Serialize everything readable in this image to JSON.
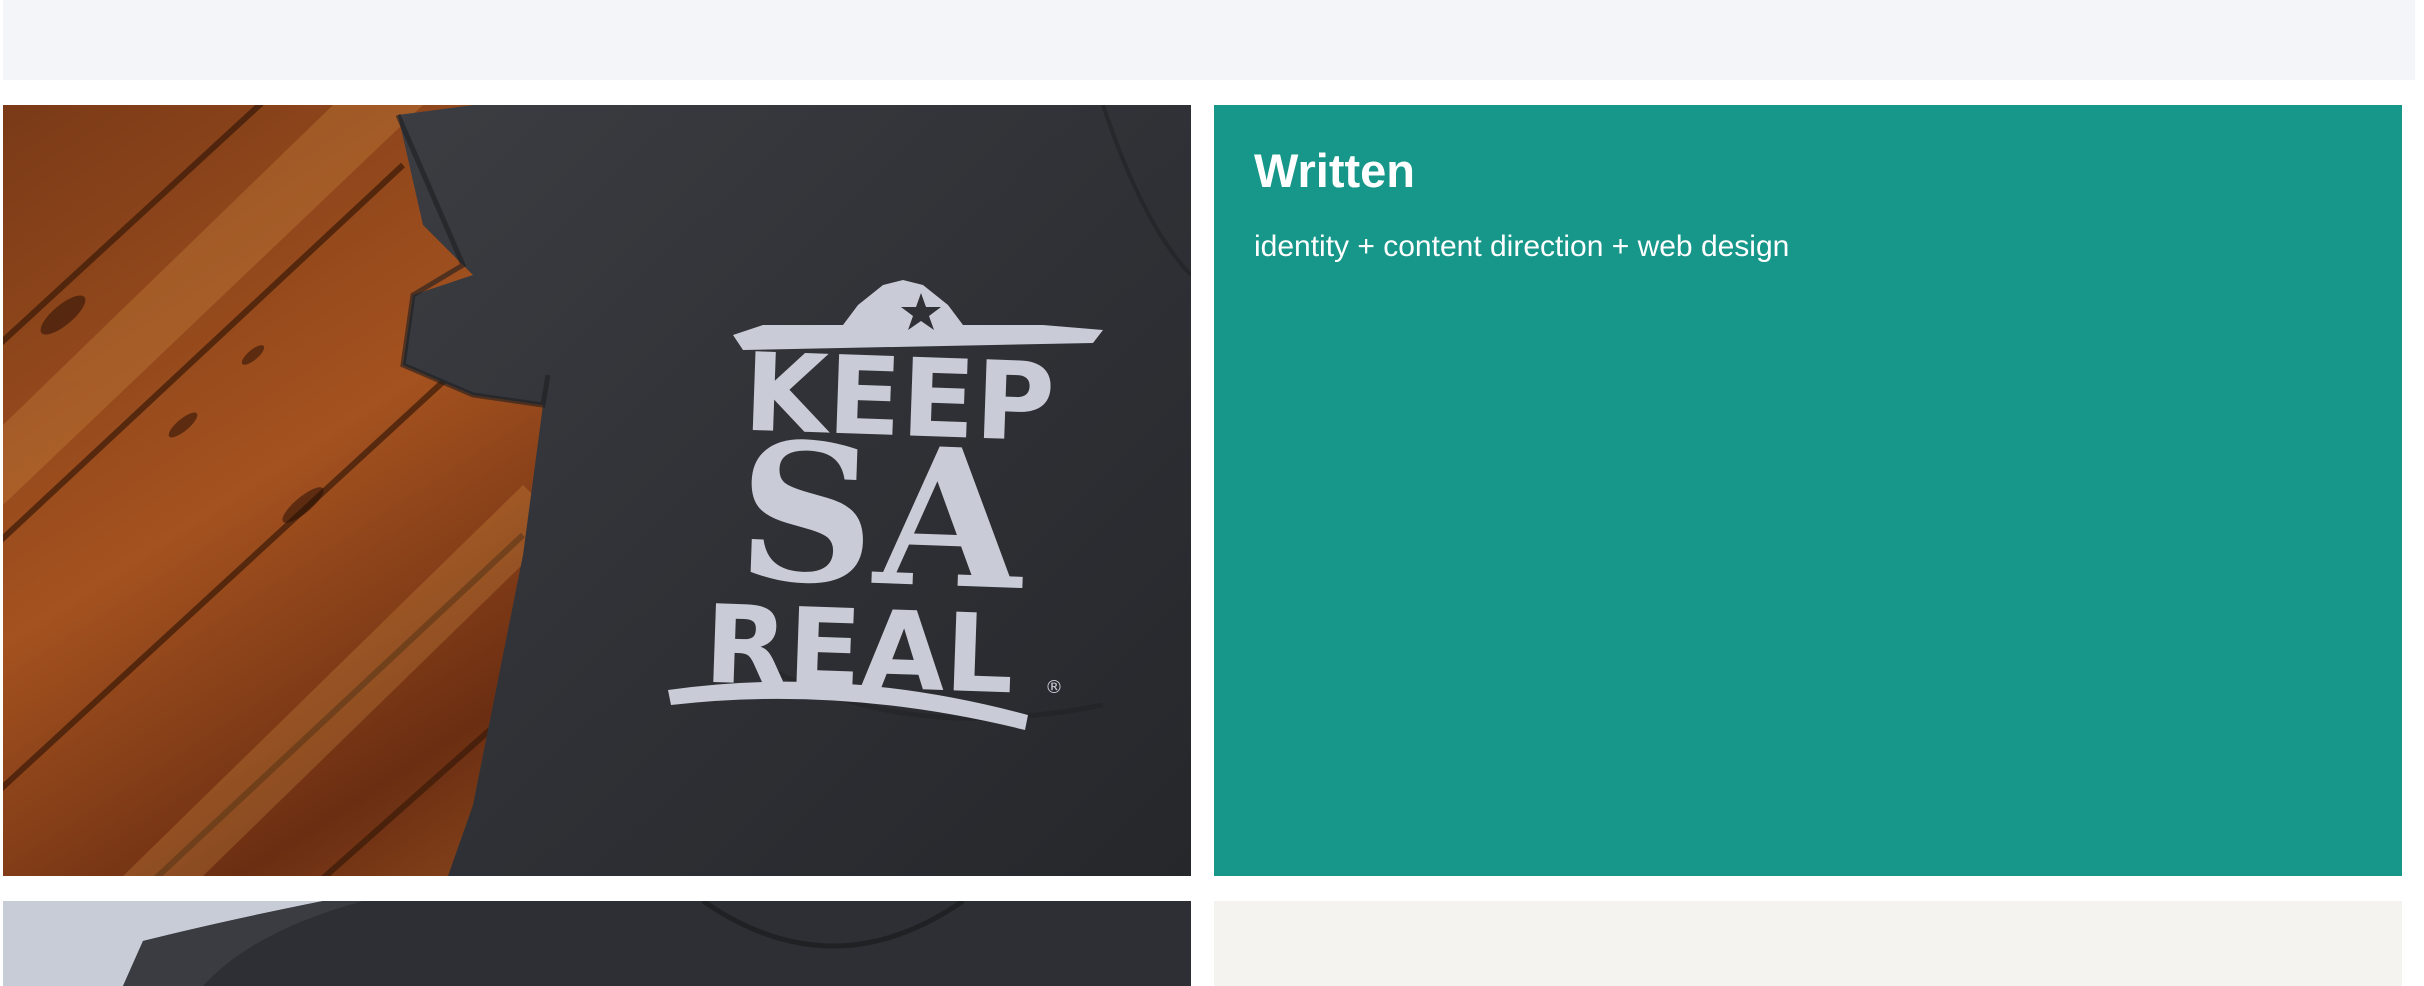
{
  "projects": [
    {
      "title": "Written",
      "services": "identity + content direction + web design",
      "accent_color": "#17978a",
      "photo": {
        "subject": "grey t-shirt on wooden floor",
        "print_lines": [
          "KEEP",
          "SA",
          "REAL"
        ],
        "print_mark": "®"
      }
    },
    {
      "accent_color": "#f4f3ef",
      "photo": {
        "subject": "grey t-shirt"
      }
    }
  ],
  "colors": {
    "page_top_band": "#f4f5f8",
    "page_bg": "#ffffff"
  }
}
